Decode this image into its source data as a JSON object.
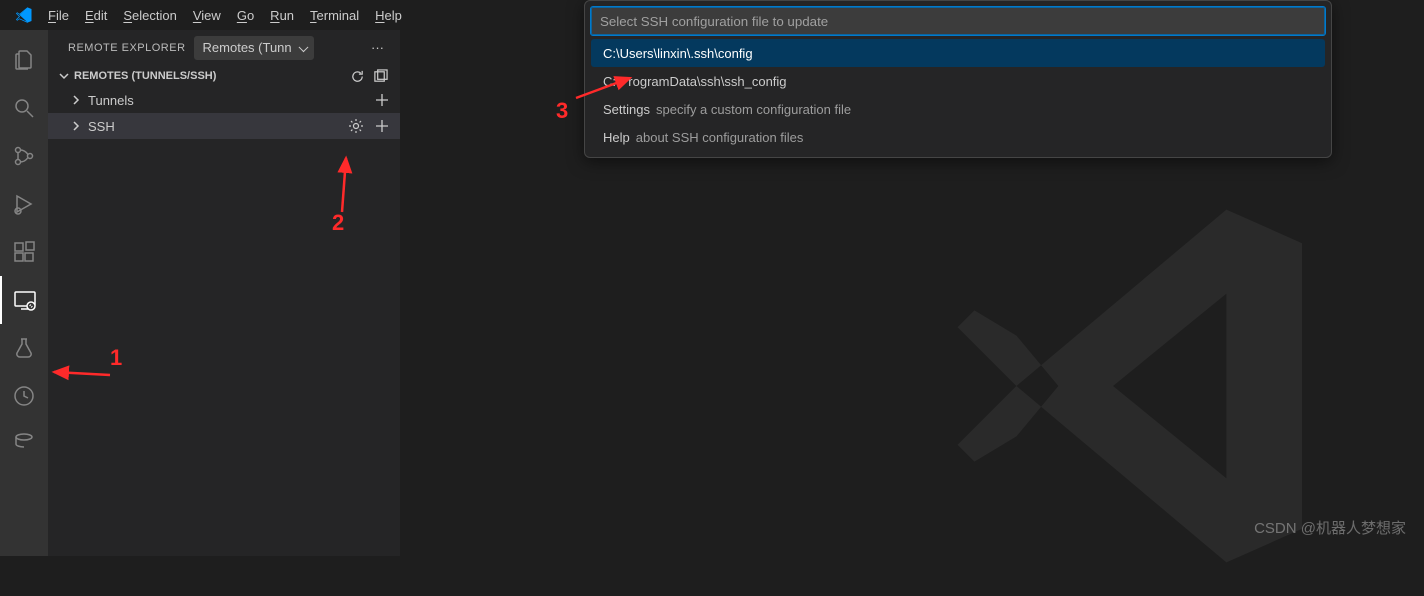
{
  "menubar": {
    "items": [
      "File",
      "Edit",
      "Selection",
      "View",
      "Go",
      "Run",
      "Terminal",
      "Help"
    ]
  },
  "sidebar": {
    "title": "REMOTE EXPLORER",
    "dropdown": "Remotes (Tunn",
    "section": "REMOTES (TUNNELS/SSH)",
    "tree": {
      "tunnels": "Tunnels",
      "ssh": "SSH"
    }
  },
  "quickinput": {
    "placeholder": "Select SSH configuration file to update",
    "items": [
      {
        "label": "C:\\Users\\linxin\\.ssh\\config"
      },
      {
        "label": "C:\\ProgramData\\ssh\\ssh_config"
      },
      {
        "label": "Settings",
        "hint": "specify a custom configuration file"
      },
      {
        "label": "Help",
        "hint": "about SSH configuration files"
      }
    ]
  },
  "annotations": {
    "a1": "1",
    "a2": "2",
    "a3": "3"
  },
  "watermark": "CSDN @机器人梦想家"
}
